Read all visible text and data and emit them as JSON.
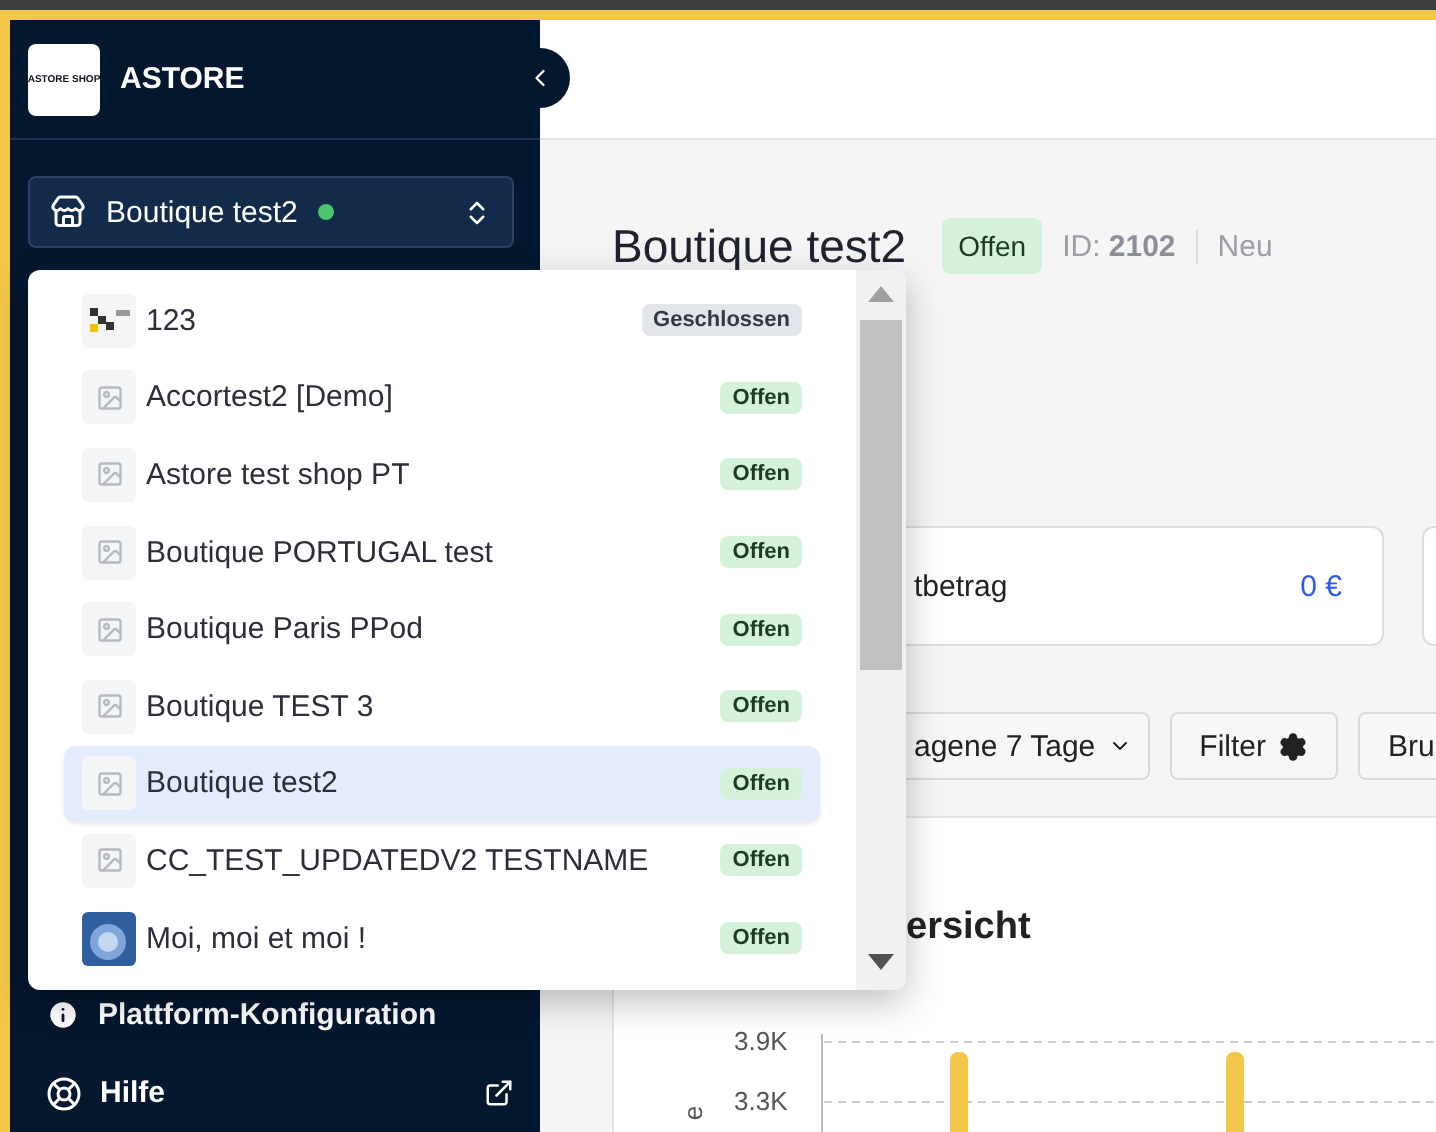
{
  "sidebar": {
    "logo_text": "ASTORE SHOP",
    "brand": "ASTORE",
    "store_select": {
      "value": "Boutique test2",
      "online": true
    },
    "bottom_items": [
      {
        "label": "Plattform-Konfiguration",
        "kind": "info",
        "external": false
      },
      {
        "label": "Hilfe",
        "kind": "help",
        "external": true
      }
    ]
  },
  "store_dropdown": {
    "items": [
      {
        "name": "123",
        "kind": "logo",
        "open": false,
        "badge": "Geschlossen",
        "selected": false
      },
      {
        "name": "Accortest2 [Demo]",
        "kind": "placeholder",
        "open": true,
        "badge": "Offen",
        "selected": false
      },
      {
        "name": "Astore test shop PT",
        "kind": "placeholder",
        "open": true,
        "badge": "Offen",
        "selected": false
      },
      {
        "name": "Boutique PORTUGAL test",
        "kind": "placeholder",
        "open": true,
        "badge": "Offen",
        "selected": false
      },
      {
        "name": "Boutique Paris PPod",
        "kind": "placeholder",
        "open": true,
        "badge": "Offen",
        "selected": false
      },
      {
        "name": "Boutique TEST 3",
        "kind": "placeholder",
        "open": true,
        "badge": "Offen",
        "selected": false
      },
      {
        "name": "Boutique test2",
        "kind": "placeholder",
        "open": true,
        "badge": "Offen",
        "selected": true
      },
      {
        "name": "CC_TEST_UPDATEDV2 TESTNAME",
        "kind": "placeholder",
        "open": true,
        "badge": "Offen",
        "selected": false
      },
      {
        "name": "Moi, moi et moi !",
        "kind": "picture",
        "open": true,
        "badge": "Offen",
        "selected": false
      }
    ]
  },
  "page": {
    "title": "Boutique test2",
    "status": {
      "label": "Offen",
      "open": true
    },
    "id_label": "ID:",
    "id_value": "2102",
    "tag": "Neu",
    "stat_cards": [
      {
        "label": "tbetrag",
        "value": "0 €"
      }
    ],
    "toolbar": [
      {
        "label": "agene 7 Tage",
        "kind": "dropdown"
      },
      {
        "label": "Filter",
        "kind": "filter"
      },
      {
        "label": "Bru",
        "kind": "plain"
      }
    ],
    "chart": {
      "title": "ersicht",
      "y_label": "e",
      "y_ticks": [
        "3.9K",
        "3.3K"
      ]
    }
  }
}
